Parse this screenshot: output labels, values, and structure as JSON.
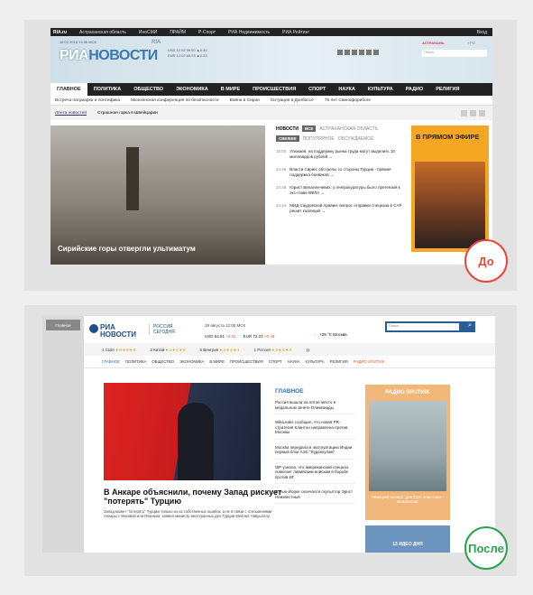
{
  "before": {
    "badge": "До",
    "topbar": [
      "RIA.ru",
      "Астраханская область",
      "ИноСМИ",
      "ПРАЙМ",
      "Р-Спорт",
      "РИА Недвижимость",
      "РИА Рейтинг",
      "Вход"
    ],
    "logo_a": "РИА",
    "logo_b": "НОВОСТИ",
    "logo_c": "RIA",
    "rates_line1": "USD 12.02  59.50 ▲0.39",
    "rates_line2": "EUR 12.02  65.93 ▲0.23",
    "date": "16.02.2016  15.55 МСК",
    "search_placeholder": "Поиск",
    "city": "АСТРАХАНЬ",
    "temp": "+7°C",
    "nav": [
      "ГЛАВНОЕ",
      "ПОЛИТИКА",
      "ОБЩЕСТВО",
      "ЭКОНОМИКА",
      "В МИРЕ",
      "ПРОИСШЕСТВИЯ",
      "СПОРТ",
      "НАУКА",
      "КУЛЬТУРА",
      "РАДИО",
      "РЕЛИГИЯ"
    ],
    "subnav": [
      "Встреча патриарха и понтифика",
      "Мюнхенская конференция по безопасности",
      "Война в Сирии",
      "Ситуация в Донбассе",
      "75 лет Свинофорибоге"
    ],
    "tape_label": "Лента новостей",
    "tape_text": "Страшная горка в Швейцарии",
    "image_caption": "Сирийские горы отвергли ультиматум",
    "news_title": "НОВОСТИ",
    "news_tabs": [
      "ВСЕ",
      "АСТРАХАНСКАЯ ОБЛАСТЬ"
    ],
    "news_subtabs": [
      "СВЕЖЕЕ",
      "ПОПУЛЯРНОЕ",
      "ОБСУЖДАЕМОЕ"
    ],
    "news": [
      {
        "time": "15:00",
        "text": "Улюкаев: на поддержку рынка труда могут выделить 10 миллиардов рублей →"
      },
      {
        "time": "14:49",
        "text": "Власти Сирии: обстрелы со стороны Турции - прямая поддержка боевиков →"
      },
      {
        "time": "14:48",
        "text": "Юрист Белаленчевих: у генпрокуратуры было претензий к экс-главе ВФЛА →"
      },
      {
        "time": "14:44",
        "text": "МИД Саудовской Аравии: вопрос отправки спецназа в САР решит коалиция →"
      }
    ],
    "ad_title": "В ПРЯМОМ ЭФИРЕ"
  },
  "after": {
    "badge": "После",
    "side_tab": "Главное",
    "logo_a": "РИА",
    "logo_b": "НОВОСТИ",
    "logo2_a": "РОССИЯ",
    "logo2_b": "СЕГОДНЯ",
    "date": "19 августа  12:00 МСК",
    "usd": "USD  64.81",
    "usd_d": "+0.02",
    "eur": "EUR  72.23",
    "eur_d": "+0.48",
    "weather": "+25 °С  Москва",
    "search_placeholder": "Поиск",
    "countries": [
      {
        "name": "1 США",
        "dots": "● 9 ● 8 ● 8"
      },
      {
        "name": "3 Китай",
        "dots": "● 4 ● 1 ● 6"
      },
      {
        "name": "5 Венгрия",
        "dots": "● 4 ● 1 ● 1"
      },
      {
        "name": "1 Россия",
        "dots": "● 3 ● 5 ● 3"
      }
    ],
    "nav": [
      "ГЛАВНОЕ",
      "ПОЛИТИКА",
      "ОБЩЕСТВО",
      "ЭКОНОМИКА",
      "В МИРЕ",
      "ПРОИСШЕСТВИЯ",
      "СПОРТ",
      "НАУКА",
      "КУЛЬТУРА",
      "РЕЛИГИЯ",
      "РАДИО SPUTNIK"
    ],
    "headline": "В Анкаре объяснили, почему Запад рискует \"потерять\" Турцию",
    "lead": "Запад может \"потерять\" Турцию только из-за собственных ошибок, а не в связи с отношениями Анкары с Москвой или Пекином, заявил министр иностранных дел Турции Мевлют Чавушоглу.",
    "col_title": "ГЛАВНОЕ",
    "items": [
      "Россия вышла на пятое место в медальном зачете Олимпиады",
      "WikiLeaks сообщил, что новая PR-стратегия Клинтон направлена против Москвы",
      "Москва передала в эксплуатацию Индии первый блок АЭС \"Куданкулам\"",
      "WP узнала, что американский спецназ помогает ливийским войскам в борьбе против ИГ",
      "В Нью-Йорке скончался скульптор Эрнст Неизвестный"
    ],
    "ad_title": "РАДИО SPUTNIK",
    "ad_caption": "Немецкий эксперт: для США этом союз – апокалипсис",
    "ad2": "13 ИДЕО ДНЯ"
  }
}
